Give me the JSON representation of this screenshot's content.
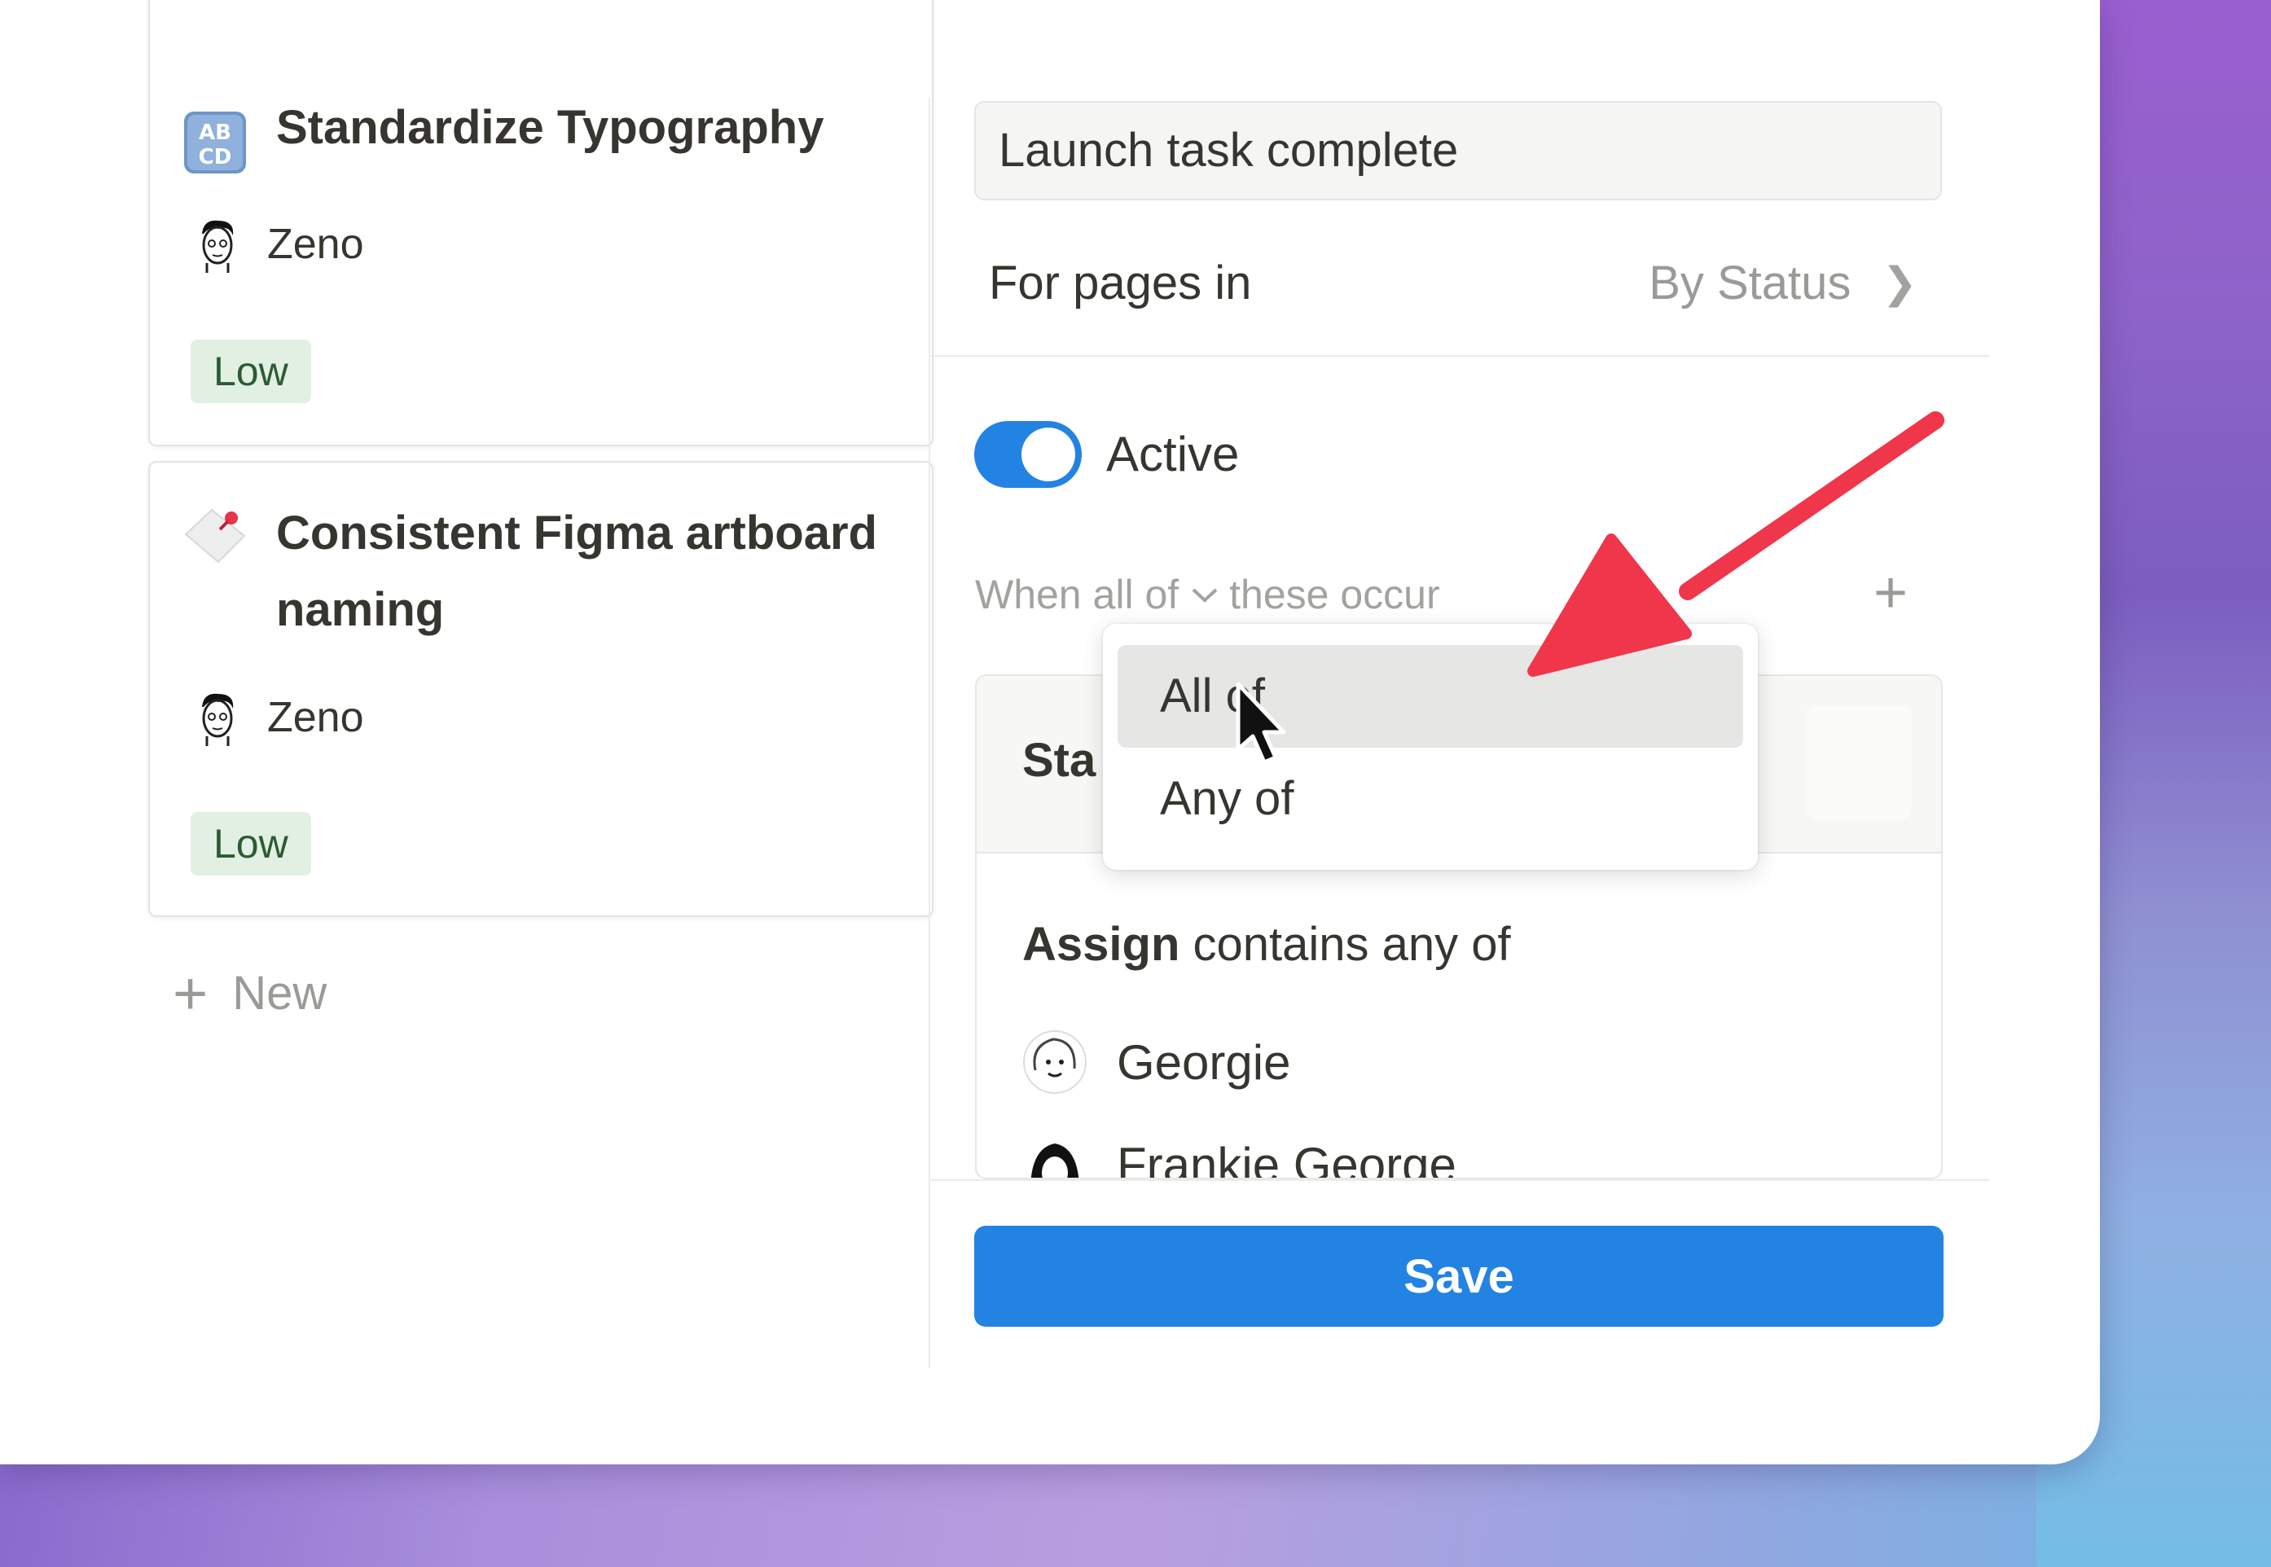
{
  "cards": [
    {
      "title": "Standardize Typography",
      "icon": "abcd-icon",
      "assignee": "Zeno",
      "priority": "Low"
    },
    {
      "title_line1": "Consistent Figma artboard",
      "title_line2": "naming",
      "icon": "pushpin-note-icon",
      "assignee": "Zeno",
      "priority": "Low"
    }
  ],
  "board": {
    "new_label": "New"
  },
  "automation": {
    "name_value": "Launch task complete",
    "pages_label": "For pages in",
    "pages_value": "By Status",
    "active_label": "Active",
    "active_on": true,
    "when_prefix": "When",
    "when_mode": "all of",
    "when_suffix": "these occur",
    "condition_header": "Sta",
    "assign_field": "Assign",
    "assign_operator": "contains any of",
    "people": [
      "Georgie",
      "Frankie George"
    ],
    "save_label": "Save"
  },
  "dropdown": {
    "options": [
      "All of",
      "Any of"
    ],
    "highlighted": "All of"
  },
  "colors": {
    "accent": "#2383e2",
    "tag_green_bg": "#e2f0e3",
    "annotation_arrow": "#f0364a"
  }
}
